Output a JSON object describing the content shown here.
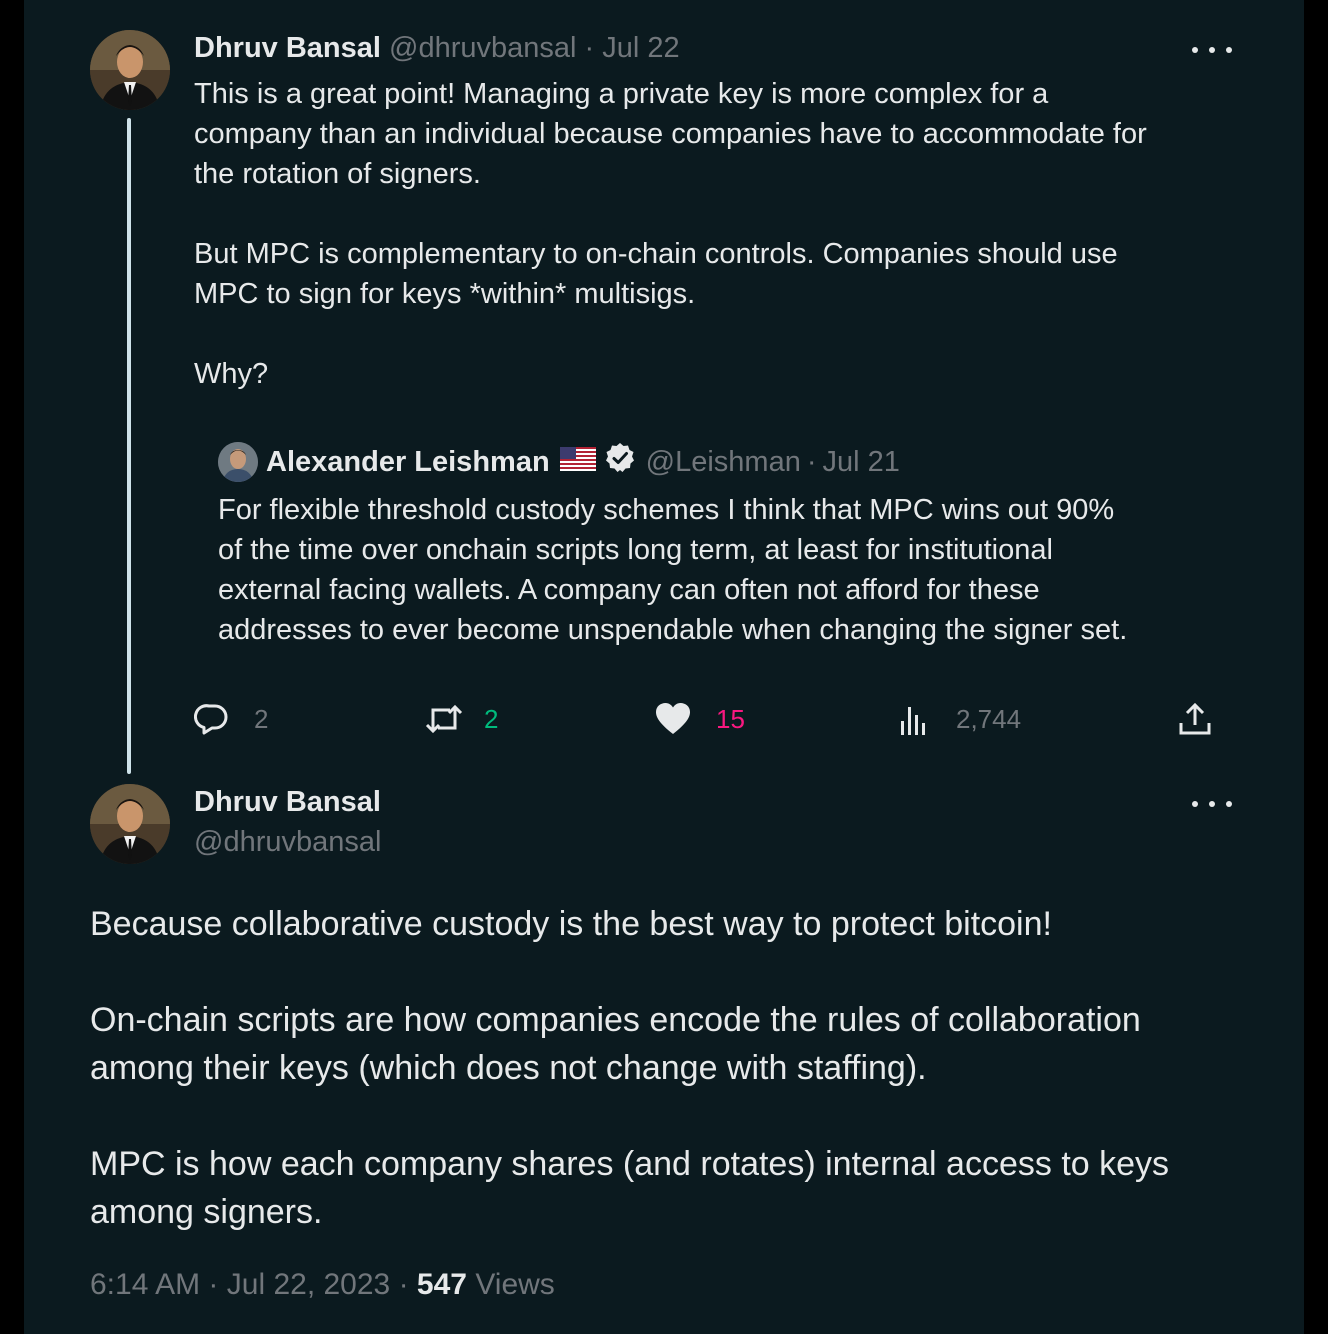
{
  "tweet1": {
    "author_name": "Dhruv Bansal",
    "handle": "@dhruvbansal",
    "date": "Jul 22",
    "sep": "·",
    "lines": [
      "This is a great point!  Managing a private key is more complex for a",
      "company than an individual because companies have to accommodate for",
      "the rotation of signers.",
      "But MPC is complementary to on-chain controls. Companies should use",
      "MPC to sign for keys *within* multisigs.",
      "Why?"
    ],
    "quoted": {
      "author_name": "Alexander Leishman",
      "handle": "@Leishman",
      "date": "Jul 21",
      "lines": [
        "For flexible threshold custody schemes I think that MPC wins out 90%",
        "of the time over onchain scripts long term, at least for institutional",
        "external facing wallets. A company can often not afford for these",
        "addresses to ever become unspendable when changing the signer set."
      ]
    },
    "actions": {
      "replies": "2",
      "retweets": "2",
      "likes": "15",
      "views": "2,744"
    }
  },
  "tweet2": {
    "author_name": "Dhruv Bansal",
    "handle": "@dhruvbansal",
    "lines": [
      "Because collaborative custody is the best way to protect bitcoin!",
      "On-chain scripts are how companies encode the rules of collaboration",
      "among their keys (which does not change with staffing).",
      "MPC is how each company shares (and rotates) internal access to keys",
      "among signers."
    ],
    "time": "6:14 AM",
    "date": "Jul 22, 2023",
    "views_count": "547",
    "views_label": "Views"
  },
  "colors": {
    "background": "#0b1a1f",
    "text": "#e7e9ea",
    "muted": "#71767b",
    "retweet_green": "#00ba7c",
    "like_pink": "#f91880",
    "verified_bg": "#e7e9ea"
  }
}
